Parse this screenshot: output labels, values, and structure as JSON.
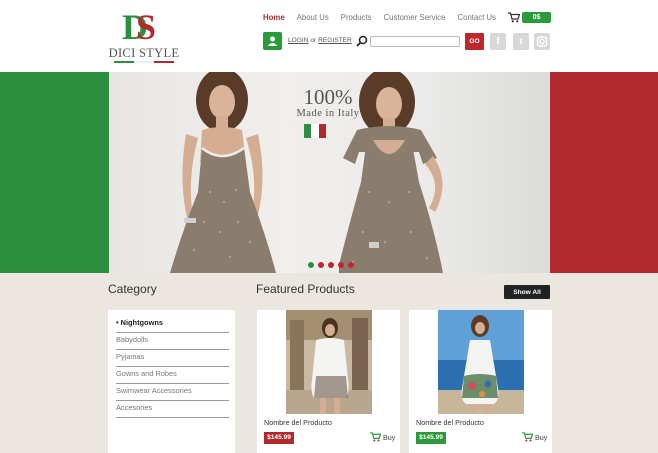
{
  "brand": {
    "logo_letters": "DS",
    "name": "DICI STYLE",
    "colors": {
      "green": "#2b8f3e",
      "white": "#ffffff",
      "red": "#b32a2e"
    }
  },
  "nav": {
    "items": [
      {
        "label": "Home",
        "active": true
      },
      {
        "label": "About Us",
        "active": false
      },
      {
        "label": "Products",
        "active": false
      },
      {
        "label": "Customer Service",
        "active": false
      },
      {
        "label": "Contact Us",
        "active": false
      }
    ]
  },
  "cart": {
    "icon": "cart-icon",
    "total": "0$"
  },
  "account": {
    "icon": "user-icon",
    "login_label": "LOGIN",
    "or_label": "or",
    "register_label": "REGISTER"
  },
  "search": {
    "icon": "search-icon",
    "value": "",
    "placeholder": "",
    "button_label": "GO"
  },
  "social": [
    {
      "icon": "facebook-icon",
      "glyph": "f"
    },
    {
      "icon": "twitter-icon",
      "glyph": "t"
    },
    {
      "icon": "instagram-icon",
      "glyph": "◙"
    }
  ],
  "hero": {
    "headline": "100%",
    "subline": "Made in Italy",
    "slide_count": 5,
    "active_slide": 1
  },
  "category": {
    "title": "Category",
    "items": [
      {
        "label": "Nightgowns",
        "active": true
      },
      {
        "label": "Babydolls",
        "active": false
      },
      {
        "label": "Pyjamas",
        "active": false
      },
      {
        "label": "Gowns and Robes",
        "active": false
      },
      {
        "label": "Swimwear Accessories",
        "active": false
      },
      {
        "label": "Accesories",
        "active": false
      }
    ]
  },
  "featured": {
    "title": "Featured Products",
    "show_all_label": "Show All",
    "products": [
      {
        "name": "Nombre del Producto",
        "price": "$145.99",
        "price_color": "#b32a2e",
        "buy_label": "Buy"
      },
      {
        "name": "Nombre del Producto",
        "price": "$145.99",
        "price_color": "#2b9a3a",
        "buy_label": "Buy"
      }
    ]
  }
}
